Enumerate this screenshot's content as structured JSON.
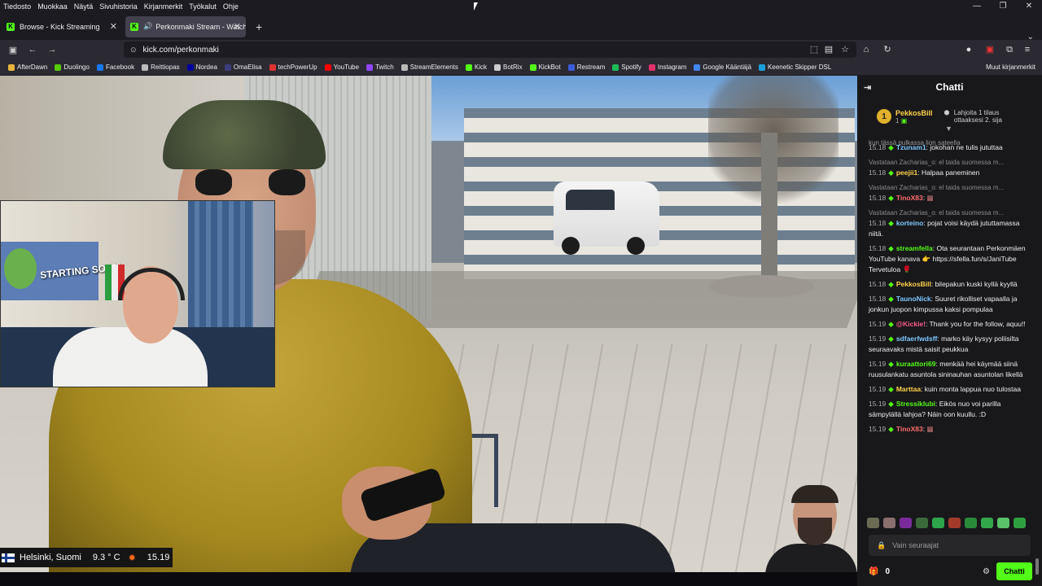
{
  "menubar": [
    "Tiedosto",
    "Muokkaa",
    "Näytä",
    "Sivuhistoria",
    "Kirjanmerkit",
    "Työkalut",
    "Ohje"
  ],
  "tabs": [
    {
      "title": "Browse - Kick Streaming",
      "active": false
    },
    {
      "title": "Perkonmaki Stream - Watch",
      "active": true
    }
  ],
  "url": "kick.com/perkonmaki",
  "bookmarks": [
    {
      "label": "AfterDawn",
      "color": "#e7b53b"
    },
    {
      "label": "Duolingo",
      "color": "#58cc02"
    },
    {
      "label": "Facebook",
      "color": "#1877f2"
    },
    {
      "label": "Reittiopas",
      "color": "#bbbbbb"
    },
    {
      "label": "Nordea",
      "color": "#0000a0"
    },
    {
      "label": "OmaElisa",
      "color": "#3d3d7a"
    },
    {
      "label": "techPowerUp",
      "color": "#d33"
    },
    {
      "label": "YouTube",
      "color": "#ff0000"
    },
    {
      "label": "Twitch",
      "color": "#9146ff"
    },
    {
      "label": "StreamElements",
      "color": "#bbbbbb"
    },
    {
      "label": "Kick",
      "color": "#53fc18"
    },
    {
      "label": "BotRix",
      "color": "#cccccc"
    },
    {
      "label": "KickBot",
      "color": "#53fc18"
    },
    {
      "label": "Restream",
      "color": "#3b5bdb"
    },
    {
      "label": "Spotify",
      "color": "#1db954"
    },
    {
      "label": "Instagram",
      "color": "#e1306c"
    },
    {
      "label": "Google Kääntäjä",
      "color": "#4285f4"
    },
    {
      "label": "Keenetic Skipper DSL",
      "color": "#1aa0d8"
    }
  ],
  "bookmarks_other": "Muut kirjanmerkit",
  "overlay": {
    "city": "Helsinki, Suomi",
    "temp": "9.3 ° C",
    "time": "15.19",
    "cam_poster": "STARTING SOON"
  },
  "chat": {
    "title": "Chatti",
    "pinned": {
      "rank": "1",
      "user": "PekkosBill",
      "sub": "1",
      "gift_text": "Lahjoita 1 tilaus ottaaksesi 2. sija"
    },
    "truncated_top": "kun tässä pulkassa lion sateella",
    "messages": [
      {
        "time": "15.18",
        "user": "Tzunam1",
        "color": "#7ec8ff",
        "text": "jokohan ne tulis jututtaa",
        "reply": ""
      },
      {
        "time": "15.18",
        "user": "peejii1",
        "color": "#ffd24a",
        "text": "Halpaa paneminen",
        "reply": "Vastataan Zacharias_o: el taida suomessa m..."
      },
      {
        "time": "15.18",
        "user": "TinoX83",
        "color": "#ff6b6b",
        "text": "",
        "reply": "Vastataan Zacharias_o: el taida suomessa m..."
      },
      {
        "time": "15.18",
        "user": "korteino",
        "color": "#7ec8ff",
        "text": "pojat voisi käydä jututtamassa niitä.",
        "reply": "Vastataan Zacharias_o: el taida suomessa m..."
      },
      {
        "time": "15.18",
        "user": "streamfella",
        "color": "#53fc18",
        "text": "Ota seurantaan Perkonmäen YouTube kanava 👉 https://sfella.fun/s/JaniTube Tervetuloa 🌹",
        "reply": ""
      },
      {
        "time": "15.18",
        "user": "PekkosBill",
        "color": "#ffd24a",
        "text": "bilepakun kuski kyllä kyyllä",
        "reply": ""
      },
      {
        "time": "15.18",
        "user": "TaunoNick",
        "color": "#7ec8ff",
        "text": "Suuret rikolliset vapaalla ja jonkun juopon kimpussa kaksi pompulaa",
        "reply": ""
      },
      {
        "time": "15.19",
        "user": "@Kickie!",
        "color": "#ff5a8a",
        "text": "Thank you for the follow, aquu!!",
        "reply": ""
      },
      {
        "time": "15.19",
        "user": "sdfaerfwdsff",
        "color": "#7ec8ff",
        "text": "marko käy kysyy poliisilta seuraavaks mistä saisit peukkua",
        "reply": ""
      },
      {
        "time": "15.19",
        "user": "kuraattori69",
        "color": "#53fc18",
        "text": "menkää hei käymää siinä ruusulankatu asuntola sininauhan asuntolan likellä",
        "reply": ""
      },
      {
        "time": "15.19",
        "user": "Marttaa",
        "color": "#ffd24a",
        "text": "kuin monta lappua nuo tulostaa",
        "reply": ""
      },
      {
        "time": "15.19",
        "user": "Stressiklubi",
        "color": "#53fc18",
        "text": "Eikös nuo voi parilla sämpylällä lahjoa? Näin oon kuullu. :D",
        "reply": ""
      },
      {
        "time": "15.19",
        "user": "TinoX83",
        "color": "#ff6b6b",
        "text": "",
        "reply": ""
      }
    ],
    "input_placeholder": "Vain seuraajat",
    "gift_count": "0",
    "send_label": "Chatti"
  }
}
